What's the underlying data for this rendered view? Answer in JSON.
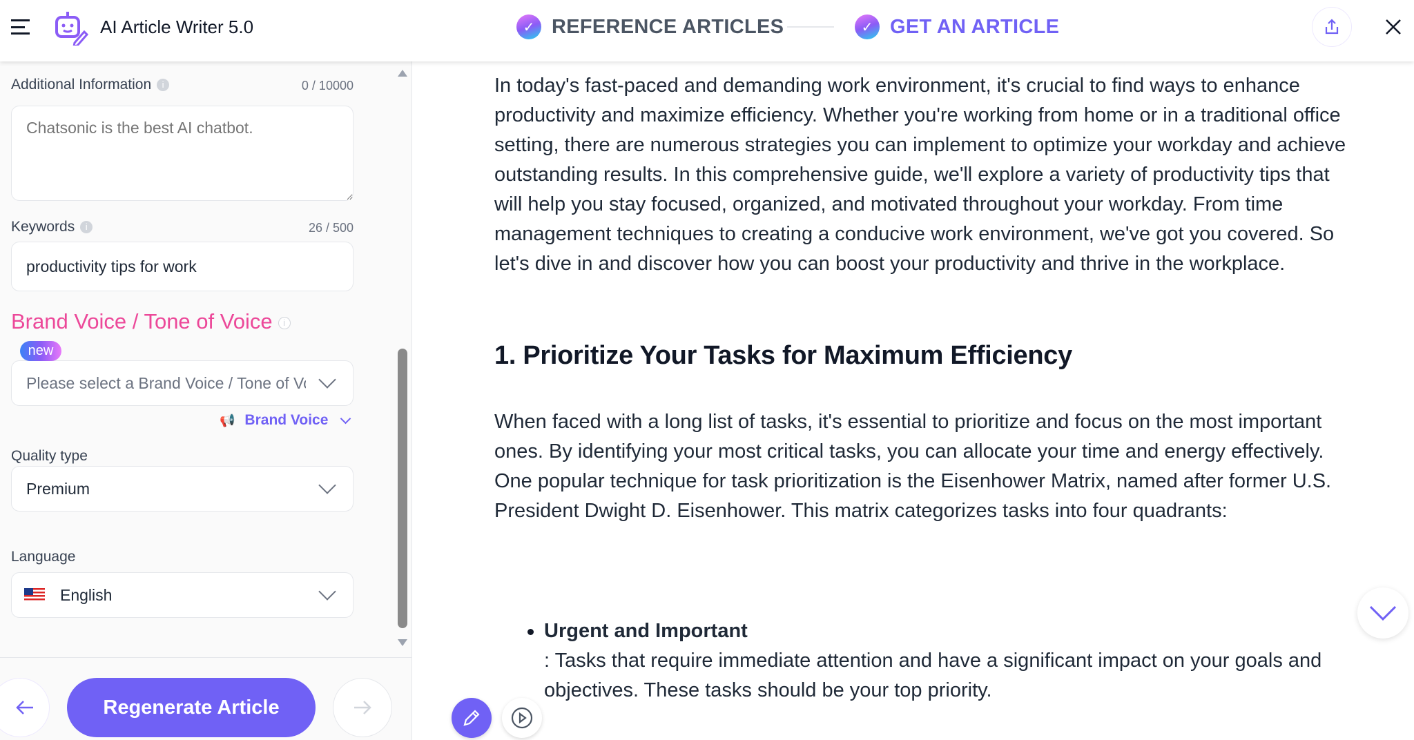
{
  "header": {
    "app_title": "AI Article Writer 5.0",
    "steps": [
      {
        "label": "REFERENCE ARTICLES",
        "color": "#4b5563"
      },
      {
        "label": "GET AN ARTICLE",
        "color": "#7061f5"
      }
    ]
  },
  "form": {
    "additional_info": {
      "label": "Additional Information",
      "counter": "0 / 10000",
      "placeholder": "Chatsonic is the best AI chatbot.",
      "value": ""
    },
    "keywords": {
      "label": "Keywords",
      "counter": "26 / 500",
      "value": "productivity tips for work"
    },
    "brand_voice": {
      "heading": "Brand Voice / Tone of Voice",
      "badge": "new",
      "placeholder": "Please select a Brand Voice / Tone of Voice",
      "link": "Brand Voice"
    },
    "quality": {
      "label": "Quality type",
      "value": "Premium"
    },
    "language": {
      "label": "Language",
      "value": "English"
    },
    "regenerate_label": "Regenerate Article"
  },
  "colors": {
    "accent": "#7061f5",
    "pink": "#ec4899"
  },
  "article": {
    "intro": "In today's fast-paced and demanding work environment, it's crucial to find ways to enhance productivity and maximize efficiency. Whether you're working from home or in a traditional office setting, there are numerous strategies you can implement to optimize your workday and achieve outstanding results. In this comprehensive guide, we'll explore a variety of productivity tips that will help you stay focused, organized, and motivated throughout your workday. From time management techniques to creating a conducive work environment, we've got you covered. So let's dive in and discover how you can boost your productivity and thrive in the workplace.",
    "heading1": "1. Prioritize Your Tasks for Maximum Efficiency",
    "para1": "When faced with a long list of tasks, it's essential to prioritize and focus on the most important ones. By identifying your most critical tasks, you can allocate your time and energy effectively. One popular technique for task prioritization is the Eisenhower Matrix, named after former U.S. President Dwight D. Eisenhower. This matrix categorizes tasks into four quadrants:",
    "bullets": [
      {
        "title": "Urgent and Important",
        "text": ": Tasks that require immediate attention and have a significant impact on your goals and objectives. These tasks should be your top priority."
      }
    ]
  }
}
